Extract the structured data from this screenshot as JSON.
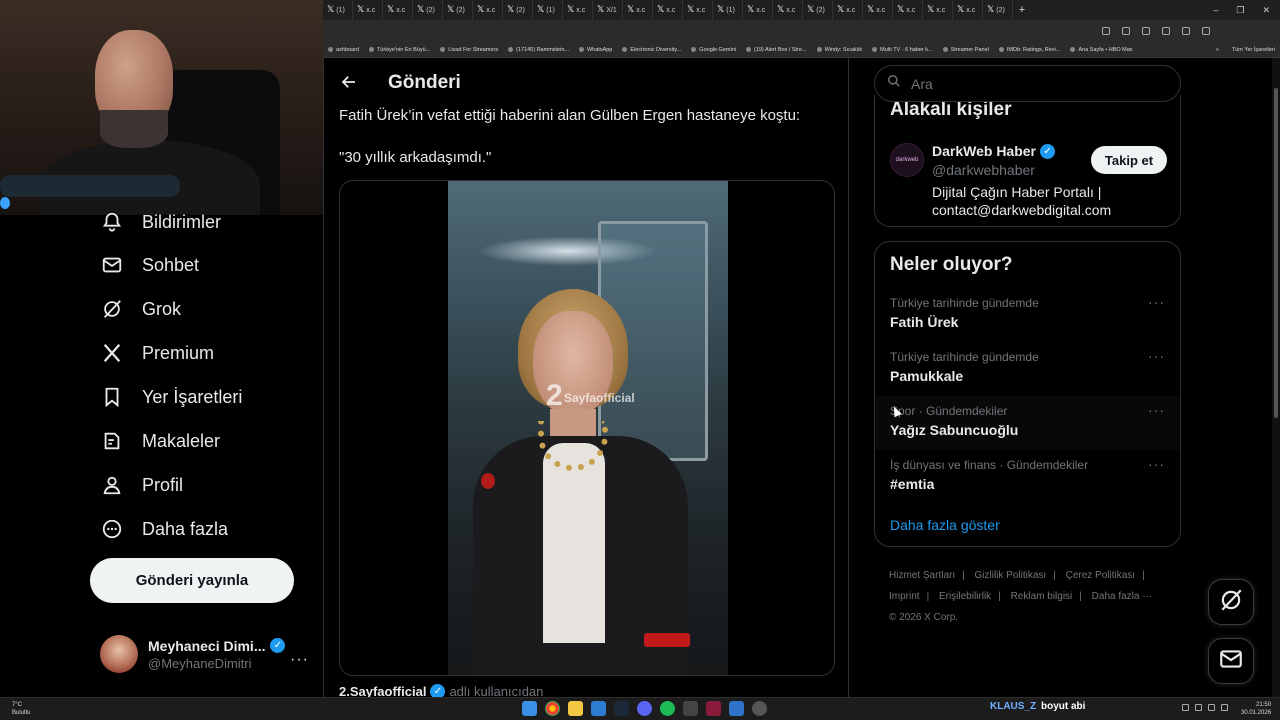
{
  "browser": {
    "tabs": [
      {
        "label": "(1)"
      },
      {
        "label": "x.c"
      },
      {
        "label": "x.c"
      },
      {
        "label": "(2)"
      },
      {
        "label": "(2)"
      },
      {
        "label": "x.c"
      },
      {
        "label": "(2)"
      },
      {
        "label": "(1)"
      },
      {
        "label": "x.c"
      },
      {
        "label": "X/1"
      },
      {
        "label": "x.c"
      },
      {
        "label": "x.c"
      },
      {
        "label": "x.c"
      },
      {
        "label": "(1)"
      },
      {
        "label": "x.c"
      },
      {
        "label": "x.c"
      },
      {
        "label": "(2)"
      },
      {
        "label": "x.c"
      },
      {
        "label": "x.c"
      },
      {
        "label": "x.c"
      },
      {
        "label": "x.c"
      },
      {
        "label": "x.c"
      },
      {
        "label": "(2)"
      }
    ],
    "new_tab": "+",
    "bookmarks": [
      "ashboard",
      "Türkiye'nin En Büyü...",
      "Livad For Streamers",
      "(17145) Rammstein...",
      "WhatsApp",
      "Electronic Diversity...",
      "Google Gemini",
      "(19) Alert Box / Stre...",
      "Windy: Sıcaklık",
      "Multi TV - 6 haber k...",
      "Streamer Panel",
      "IMDb: Ratings, Revi...",
      "Ana Sayfa • HBO Max"
    ],
    "bookmarks_more": "»",
    "bookmarks_folder": "Tüm Yer İşaretleri"
  },
  "nav": {
    "items": [
      {
        "label": "Bildirimler",
        "icon": "bell-icon"
      },
      {
        "label": "Sohbet",
        "icon": "mail-icon"
      },
      {
        "label": "Grok",
        "icon": "grok-icon"
      },
      {
        "label": "Premium",
        "icon": "x-logo-icon"
      },
      {
        "label": "Yer İşaretleri",
        "icon": "bookmark-icon"
      },
      {
        "label": "Makaleler",
        "icon": "article-icon"
      },
      {
        "label": "Profil",
        "icon": "person-icon"
      },
      {
        "label": "Daha fazla",
        "icon": "more-circle-icon"
      }
    ],
    "post_button": "Gönderi yayınla",
    "account": {
      "name": "Meyhaneci Dimi...",
      "handle": "@MeyhaneDimitri",
      "more": "···"
    }
  },
  "main": {
    "title": "Gönderi",
    "text_line1": "Fatih Ürek’in vefat ettiği haberini alan Gülben Ergen hastaneye koştu:",
    "text_line2": "\"30 yıllık arkadaşımdı.\"",
    "watermark_number": "2",
    "watermark_text": "Sayfaofficial",
    "source_name": "2.Sayfaofficial",
    "source_suffix": "adlı kullanıcıdan"
  },
  "sidebar": {
    "search_placeholder": "Ara",
    "relevant": {
      "title": "Alakalı kişiler",
      "name": "DarkWeb Haber",
      "avatar_text": "darkweb",
      "handle": "@darkwebhaber",
      "bio": "Dijital Çağın Haber Portalı | contact@darkwebdigital.com",
      "follow": "Takip et"
    },
    "trends": {
      "title": "Neler oluyor?",
      "items": [
        {
          "context": "Türkiye tarihinde gündemde",
          "title": "Fatih Ürek",
          "more": "···"
        },
        {
          "context": "Türkiye tarihinde gündemde",
          "title": "Pamukkale",
          "more": "···"
        },
        {
          "context": "Spor · Gündemdekiler",
          "title": "Yağız Sabuncuoğlu",
          "more": "···"
        },
        {
          "context": "İş dünyası ve finans · Gündemdekiler",
          "title": "#emtia",
          "more": "···"
        }
      ],
      "show_more": "Daha fazla göster"
    },
    "footer": {
      "links": [
        "Hizmet Şartları",
        "Gizlilik Politikası",
        "Çerez Politikası",
        "Imprint",
        "Erişilebilirlik",
        "Reklam bilgisi",
        "Daha fazla ···"
      ],
      "copyright": "© 2026 X Corp."
    }
  },
  "taskbar": {
    "weather_temp": "7°C",
    "weather_desc": "Bulutlu",
    "chat_name": "KLAUS_Z",
    "chat_message": "boyut abi",
    "time": "21:50",
    "date": "30.01.2026"
  },
  "colors": {
    "accent": "#1d9bf0",
    "background": "#000000",
    "text": "#e7e9ea",
    "muted": "#71767b",
    "border": "#2f3336"
  }
}
